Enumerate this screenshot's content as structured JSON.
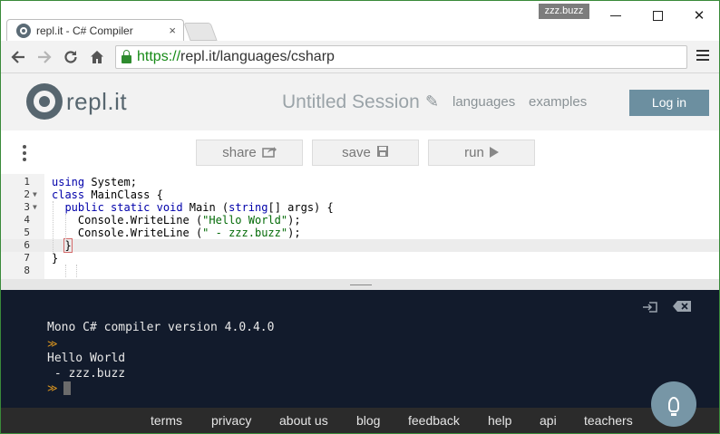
{
  "browser": {
    "tab_title": "repl.it - C# Compiler",
    "tab_close": "×",
    "user_badge": "zzz.buzz",
    "window_close": "✕",
    "url_scheme": "https://",
    "url_rest": "repl.it/languages/csharp",
    "icons": [
      "back-icon",
      "forward-icon",
      "reload-icon",
      "home-icon",
      "lock-icon",
      "menu-icon"
    ]
  },
  "header": {
    "logo_text": "repl.it",
    "session_title": "Untitled Session",
    "nav": [
      {
        "label": "languages"
      },
      {
        "label": "examples"
      }
    ],
    "login_label": "Log in"
  },
  "actions": {
    "share_label": "share",
    "save_label": "save",
    "run_label": "run"
  },
  "editor": {
    "active_line": 6,
    "lines": [
      {
        "num": "1"
      },
      {
        "num": "2"
      },
      {
        "num": "3"
      },
      {
        "num": "4"
      },
      {
        "num": "5"
      },
      {
        "num": "6"
      },
      {
        "num": "7"
      },
      {
        "num": "8"
      }
    ],
    "code": {
      "l1_kw": "using",
      "l1_rest": " System;",
      "l2_kw": "class",
      "l2_rest": " MainClass {",
      "l3_kw1": "public",
      "l3_kw2": "static",
      "l3_kw3": "void",
      "l3_rest": " Main (",
      "l3_kw4": "string",
      "l3_tail": "[] args) {",
      "l4_pre": "    Console.WriteLine (",
      "l4_str": "\"Hello World\"",
      "l4_post": ");",
      "l5_pre": "    Console.WriteLine (",
      "l5_str": "\" - zzz.buzz\"",
      "l5_post": ");",
      "l6_brace": "}",
      "l7": "}"
    }
  },
  "console": {
    "version_line": "Mono C# compiler version 4.0.4.0",
    "prompt": "≫",
    "output_1": "Hello World",
    "output_2": " - zzz.buzz"
  },
  "footer": {
    "links": [
      "terms",
      "privacy",
      "about us",
      "blog",
      "feedback",
      "help",
      "api",
      "teachers"
    ]
  }
}
